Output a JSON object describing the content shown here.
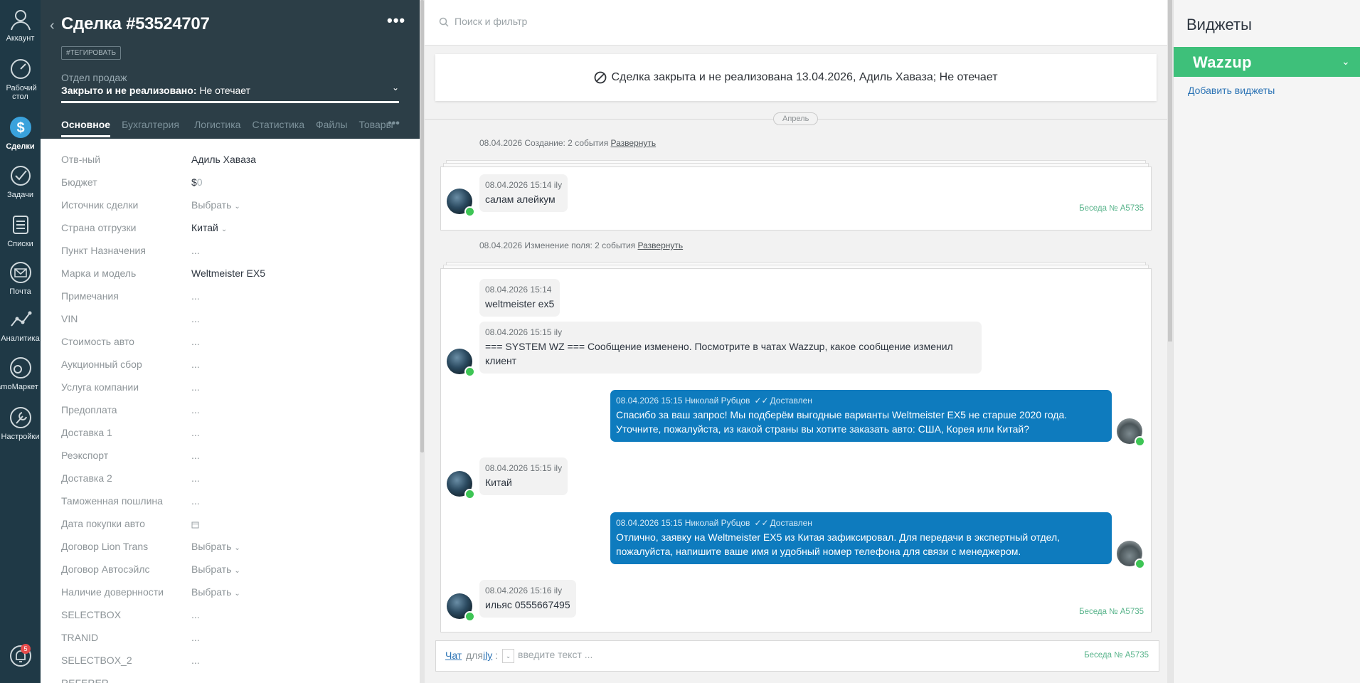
{
  "nav": {
    "account": "Аккаунт",
    "desktop": "Рабочий стол",
    "deals": "Сделки",
    "tasks": "Задачи",
    "lists": "Списки",
    "mail": "Почта",
    "analytics": "Аналитика",
    "market": "amoМаркет",
    "settings": "Настройки",
    "notifications_count": "5"
  },
  "card": {
    "title": "Сделка #53524707",
    "menu": "•••",
    "tag_button": "#ТЕГИРОВАТЬ",
    "pipeline": "Отдел продаж",
    "status_bold": "Закрыто и не реализовано:",
    "status_reason": " Не отечает",
    "tabs": [
      "Основное",
      "Бухгалтерия",
      "Логистика",
      "Статистика",
      "Файлы",
      "Товары"
    ],
    "tabs_more": "•••",
    "fields": [
      {
        "label": "Отв-ный",
        "value": "Адиль Хаваза"
      },
      {
        "label": "Бюджет",
        "value": "$",
        "extra": "0"
      },
      {
        "label": "Источник сделки",
        "value": "Выбрать"
      },
      {
        "label": "Страна отгрузки",
        "value": "Китай"
      },
      {
        "label": "Пункт Назначения",
        "value": "..."
      },
      {
        "label": "Марка и модель",
        "value": "Weltmeister EX5"
      },
      {
        "label": "Примечания",
        "value": "..."
      },
      {
        "label": "VIN",
        "value": "..."
      },
      {
        "label": "Стоимость авто",
        "value": "..."
      },
      {
        "label": "Аукционный сбор",
        "value": "..."
      },
      {
        "label": "Услуга компании",
        "value": "..."
      },
      {
        "label": "Предоплата",
        "value": "..."
      },
      {
        "label": "Доставка 1",
        "value": "..."
      },
      {
        "label": "Реэкспорт",
        "value": "..."
      },
      {
        "label": "Доставка 2",
        "value": "..."
      },
      {
        "label": "Таможенная пошлина",
        "value": "..."
      },
      {
        "label": "Дата покупки авто",
        "value": ""
      },
      {
        "label": "Договор Lion Trans",
        "value": "Выбрать"
      },
      {
        "label": "Договор Автосэйлс",
        "value": "Выбрать"
      },
      {
        "label": "Наличие довернности",
        "value": "Выбрать"
      },
      {
        "label": "SELECTBOX",
        "value": "..."
      },
      {
        "label": "TRANID",
        "value": "..."
      },
      {
        "label": "SELECTBOX_2",
        "value": "..."
      },
      {
        "label": "REFERER",
        "value": ""
      }
    ]
  },
  "feed": {
    "search_placeholder": "Поиск и фильтр",
    "closed_banner": "Сделка закрыта и не реализована 13.04.2026, Адиль Хаваза; Не отечает",
    "month": "Апрель",
    "group1": {
      "text": "08.04.2026 Создание: 2 события ",
      "link": "Развернуть"
    },
    "group2": {
      "text": "08.04.2026 Изменение поля: 2 события ",
      "link": "Развернуть"
    },
    "conversation": "Беседа № A5735",
    "messages": [
      {
        "meta": "08.04.2026 15:14 ily",
        "text": "салам алейкум"
      },
      {
        "meta": "08.04.2026 15:14",
        "text": "weltmeister ex5"
      },
      {
        "meta": "08.04.2026 15:15 ily",
        "text": "=== SYSTEM WZ === Сообщение изменено. Посмотрите в чатах Wazzup, какое сообщение изменил клиент"
      },
      {
        "meta": "08.04.2026 15:15 Николай Рубцов",
        "status": "Доставлен",
        "text": "Спасибо за ваш запрос! Мы подберём выгодные варианты Weltmeister EX5 не старше 2020 года. Уточните, пожалуйста, из какой страны вы хотите заказать авто: США, Корея или Китай?"
      },
      {
        "meta": "08.04.2026 15:15 ily",
        "text": "Китай"
      },
      {
        "meta": "08.04.2026 15:15 Николай Рубцов",
        "status": "Доставлен",
        "text": "Отлично, заявку на Weltmeister EX5 из Китая зафиксировал. Для передачи в экспертный отдел, пожалуйста, напишите ваше имя и удобный номер телефона для связи с менеджером."
      },
      {
        "meta": "08.04.2026 15:16 ily",
        "text": "ильяс 0555667495"
      }
    ],
    "composer": {
      "chat": "Чат",
      "for": "для",
      "recipient": "ily",
      "colon": ":",
      "placeholder": "введите текст ...",
      "conversation": "Беседа № A5735"
    }
  },
  "widgets": {
    "title": "Виджеты",
    "wazzup": "Wazzup",
    "add": "Добавить виджеты"
  }
}
